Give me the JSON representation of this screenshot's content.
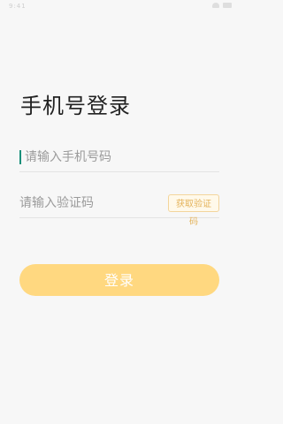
{
  "status_bar": {
    "left_text": "9:41",
    "icons": [
      "wifi-icon",
      "battery-icon"
    ]
  },
  "page": {
    "title": "手机号登录"
  },
  "phone": {
    "placeholder": "请输入手机号码",
    "value": ""
  },
  "code": {
    "placeholder": "请输入验证码",
    "value": "",
    "button_label": "获取验证码"
  },
  "login": {
    "label": "登录"
  },
  "colors": {
    "accent": "#ffd880",
    "accent_border": "#f3d59c",
    "caret": "#1a8f7a"
  }
}
